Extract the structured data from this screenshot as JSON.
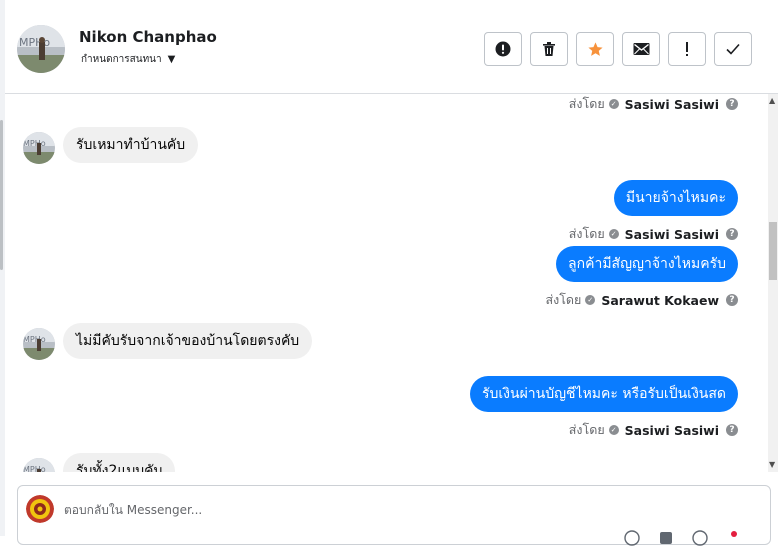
{
  "header": {
    "contact_name": "Nikon Chanphao",
    "assign_label": "กำหนดการสนทนา",
    "actions": [
      {
        "name": "spam-button",
        "icon": "alert-circle-icon"
      },
      {
        "name": "delete-button",
        "icon": "trash-icon"
      },
      {
        "name": "star-button",
        "icon": "star-icon",
        "color": "#f7923b"
      },
      {
        "name": "mark-unread-button",
        "icon": "envelope-icon"
      },
      {
        "name": "follow-up-button",
        "icon": "exclamation-icon"
      },
      {
        "name": "mark-done-button",
        "icon": "checkmark-icon"
      }
    ]
  },
  "conversation": {
    "sent_by_label": "ส่งโดย",
    "messages": [
      {
        "direction": "meta",
        "sender": "Sasiwi Sasiwi"
      },
      {
        "direction": "incoming",
        "text": "รับเหมาทำบ้านคับ"
      },
      {
        "direction": "outgoing",
        "text": "มีนายจ้างไหมคะ"
      },
      {
        "direction": "meta",
        "sender": "Sasiwi Sasiwi"
      },
      {
        "direction": "outgoing",
        "text": "ลูกค้ามีสัญญาจ้างไหมครับ"
      },
      {
        "direction": "meta",
        "sender": "Sarawut Kokaew"
      },
      {
        "direction": "incoming",
        "text": "ไม่มีคับรับจากเจ้าของบ้านโดยตรงคับ"
      },
      {
        "direction": "outgoing",
        "text": "รับเงินผ่านบัญชีไหมคะ หรือรับเป็นเงินสด"
      },
      {
        "direction": "meta",
        "sender": "Sasiwi Sasiwi"
      },
      {
        "direction": "incoming",
        "text": "รับทั้ง2แบบคับ"
      }
    ]
  },
  "composer": {
    "placeholder": "ตอบกลับใน Messenger..."
  },
  "colors": {
    "outgoing_bubble": "#0a7cff",
    "incoming_bubble": "#f0f0f0",
    "star": "#f7923b"
  }
}
